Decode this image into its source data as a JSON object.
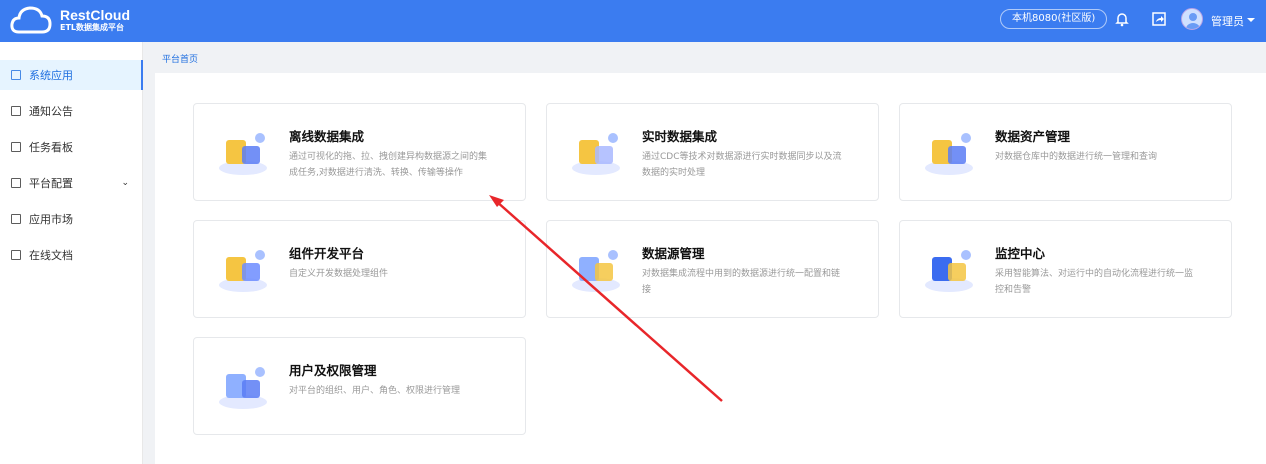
{
  "header": {
    "brand": "RestCloud",
    "subtitle": "ETL数据集成平台",
    "environment": "本机8080(社区版)",
    "user": "管理员"
  },
  "sidebar": {
    "items": [
      {
        "label": "系统应用",
        "active": true
      },
      {
        "label": "通知公告"
      },
      {
        "label": "任务看板"
      },
      {
        "label": "平台配置",
        "expandable": true
      },
      {
        "label": "应用市场"
      },
      {
        "label": "在线文档"
      }
    ]
  },
  "breadcrumb": "平台首页",
  "cards": [
    {
      "title": "离线数据集成",
      "desc": "通过可视化的拖、拉、拽创建异构数据源之间的集成任务,对数据进行清洗、转换、传输等操作"
    },
    {
      "title": "实时数据集成",
      "desc": "通过CDC等技术对数据源进行实时数据同步以及流数据的实时处理"
    },
    {
      "title": "数据资产管理",
      "desc": "对数据仓库中的数据进行统一管理和查询"
    },
    {
      "title": "组件开发平台",
      "desc": "自定义开发数据处理组件"
    },
    {
      "title": "数据源管理",
      "desc": "对数据集成流程中用到的数据源进行统一配置和链接"
    },
    {
      "title": "监控中心",
      "desc": "采用智能算法、对运行中的自动化流程进行统一监控和告警"
    },
    {
      "title": "用户及权限管理",
      "desc": "对平台的组织、用户、角色、权限进行管理"
    }
  ],
  "colors": {
    "primary": "#3b7cf0",
    "annotation": "#e8262a"
  }
}
